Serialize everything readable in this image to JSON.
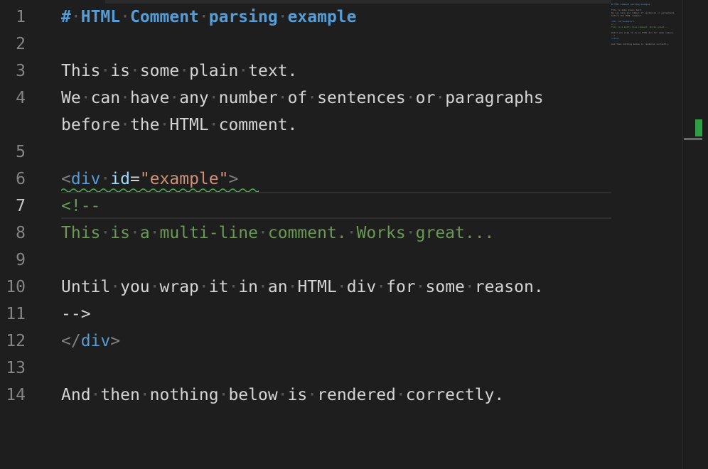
{
  "editor": {
    "line_numbers": [
      "1",
      "2",
      "3",
      "4",
      "5",
      "6",
      "7",
      "8",
      "9",
      "10",
      "11",
      "12",
      "13",
      "14"
    ],
    "active_line": "7",
    "lines": {
      "l1_hash": "#",
      "l1_w1": "HTML",
      "l1_w2": "Comment",
      "l1_w3": "parsing",
      "l1_w4": "example",
      "l3": "This is some plain text.",
      "l4": "We can have any number of sentences or paragraphs",
      "l4b": "before the HTML comment.",
      "l6_open": "<",
      "l6_tag": "div",
      "l6_attr": "id",
      "l6_eq": "=",
      "l6_val": "\"example\"",
      "l6_close": ">",
      "l7": "<!--",
      "l8": "This is a multi-line comment. Works great...",
      "l10": "Until you wrap it in an HTML div for some reason.",
      "l11": "-->",
      "l12_open": "</",
      "l12_tag": "div",
      "l12_close": ">",
      "l14": "And then nothing below is rendered correctly."
    }
  },
  "minimap": {
    "lines": [
      "# HTML Comment parsing example",
      "This is some plain text.",
      "We can have any number of sentences or paragraphs",
      "before the HTML comment.",
      "<div id=\"example\">",
      "<!--",
      "This is a multi-line comment. Works great...",
      "Until you wrap it in an HTML div for some reason.",
      "-->",
      "</div>",
      "And then nothing below is rendered correctly."
    ]
  },
  "colors": {
    "background": "#1e1e1e",
    "heading": "#569cd6",
    "tag": "#569cd6",
    "attribute": "#9cdcfe",
    "string": "#ce9178",
    "comment": "#6a9955",
    "text": "#d4d4d4",
    "line_number": "#858585",
    "scroll_marker": "#2ea043"
  }
}
